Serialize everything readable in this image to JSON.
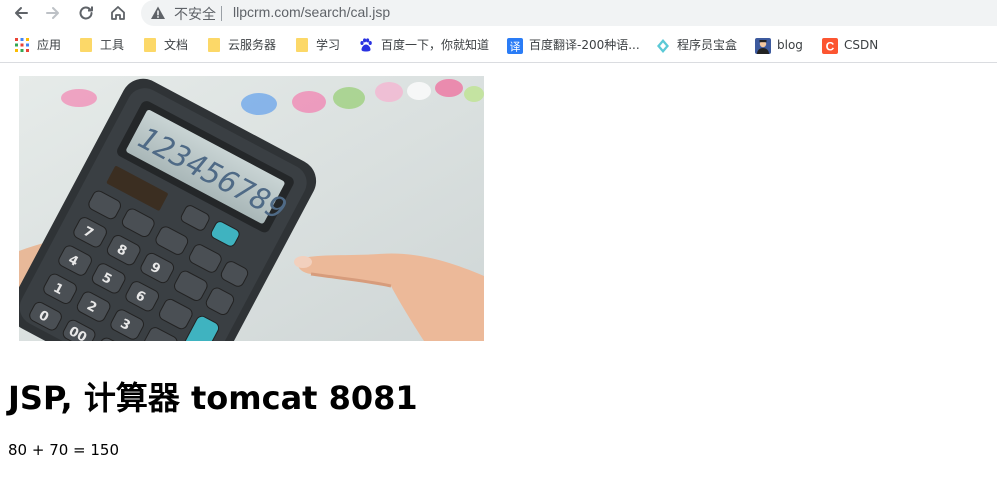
{
  "browser": {
    "security_status": "不安全",
    "url": "llpcrm.com/search/cal.jsp"
  },
  "bookmarks": [
    {
      "label": "应用",
      "icon": "apps-grid-icon"
    },
    {
      "label": "工具",
      "icon": "folder-icon"
    },
    {
      "label": "文档",
      "icon": "folder-icon"
    },
    {
      "label": "云服务器",
      "icon": "folder-icon"
    },
    {
      "label": "学习",
      "icon": "folder-icon"
    },
    {
      "label": "百度一下，你就知道",
      "icon": "baidu-paw-icon"
    },
    {
      "label": "百度翻译-200种语...",
      "icon": "baidu-translate-icon"
    },
    {
      "label": "程序员宝盒",
      "icon": "toolbox-icon"
    },
    {
      "label": "blog",
      "icon": "blog-avatar-icon"
    },
    {
      "label": "CSDN",
      "icon": "csdn-icon"
    }
  ],
  "page": {
    "title": "JSP, 计算器 tomcat 8081",
    "result": "80 + 70 = 150",
    "hero_display": "123456789"
  },
  "colors": {
    "omnibox_bg": "#f1f3f4",
    "folder": "#fcd868",
    "csdn": "#fc5531",
    "baidu_translate": "#2a7cf6",
    "calculator_body": "#2f3336",
    "teal_key": "#3fb3c0"
  }
}
